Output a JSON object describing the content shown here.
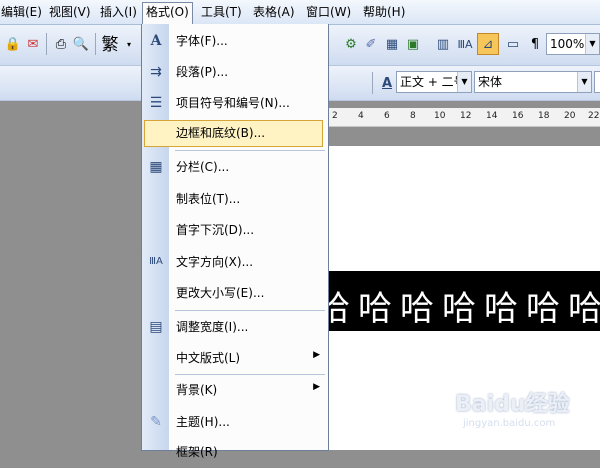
{
  "menubar": {
    "items": [
      "编辑(E)",
      "视图(V)",
      "插入(I)",
      "格式(O)",
      "工具(T)",
      "表格(A)",
      "窗口(W)",
      "帮助(H)"
    ]
  },
  "toolbar": {
    "traditional": "繁",
    "zoom": "100%",
    "style_combo": "正文 + 二号",
    "font_combo": "宋体"
  },
  "ruler": {
    "ticks": [
      "2",
      "4",
      "6",
      "8",
      "10",
      "12",
      "14",
      "16",
      "18",
      "20",
      "22"
    ]
  },
  "document": {
    "chars": [
      "哈",
      "哈",
      "哈",
      "哈",
      "哈",
      "哈",
      "哈"
    ]
  },
  "format_menu": {
    "items": [
      {
        "label": "字体(F)...",
        "icon": "font-icon",
        "glyph": "A"
      },
      {
        "label": "段落(P)...",
        "icon": "paragraph-icon",
        "glyph": "⇉"
      },
      {
        "label": "项目符号和编号(N)...",
        "icon": "bullets-icon",
        "glyph": "☰"
      },
      {
        "label": "边框和底纹(B)...",
        "icon": "",
        "glyph": ""
      },
      {
        "label": "分栏(C)...",
        "icon": "columns-icon",
        "glyph": "▦"
      },
      {
        "label": "制表位(T)...",
        "icon": "",
        "glyph": ""
      },
      {
        "label": "首字下沉(D)...",
        "icon": "",
        "glyph": ""
      },
      {
        "label": "文字方向(X)...",
        "icon": "text-direction-icon",
        "glyph": "ⅢA"
      },
      {
        "label": "更改大小写(E)...",
        "icon": "",
        "glyph": ""
      },
      {
        "label": "调整宽度(I)...",
        "icon": "adjust-width-icon",
        "glyph": "▤"
      },
      {
        "label": "中文版式(L)",
        "icon": "",
        "glyph": "",
        "submenu": true
      },
      {
        "label": "背景(K)",
        "icon": "",
        "glyph": "",
        "submenu": true
      },
      {
        "label": "主题(H)...",
        "icon": "theme-icon",
        "glyph": "✎"
      },
      {
        "label": "框架(R)",
        "icon": "",
        "glyph": ""
      }
    ]
  },
  "watermark": {
    "brand": "Baidu经验",
    "url": "jingyan.baidu.com"
  }
}
